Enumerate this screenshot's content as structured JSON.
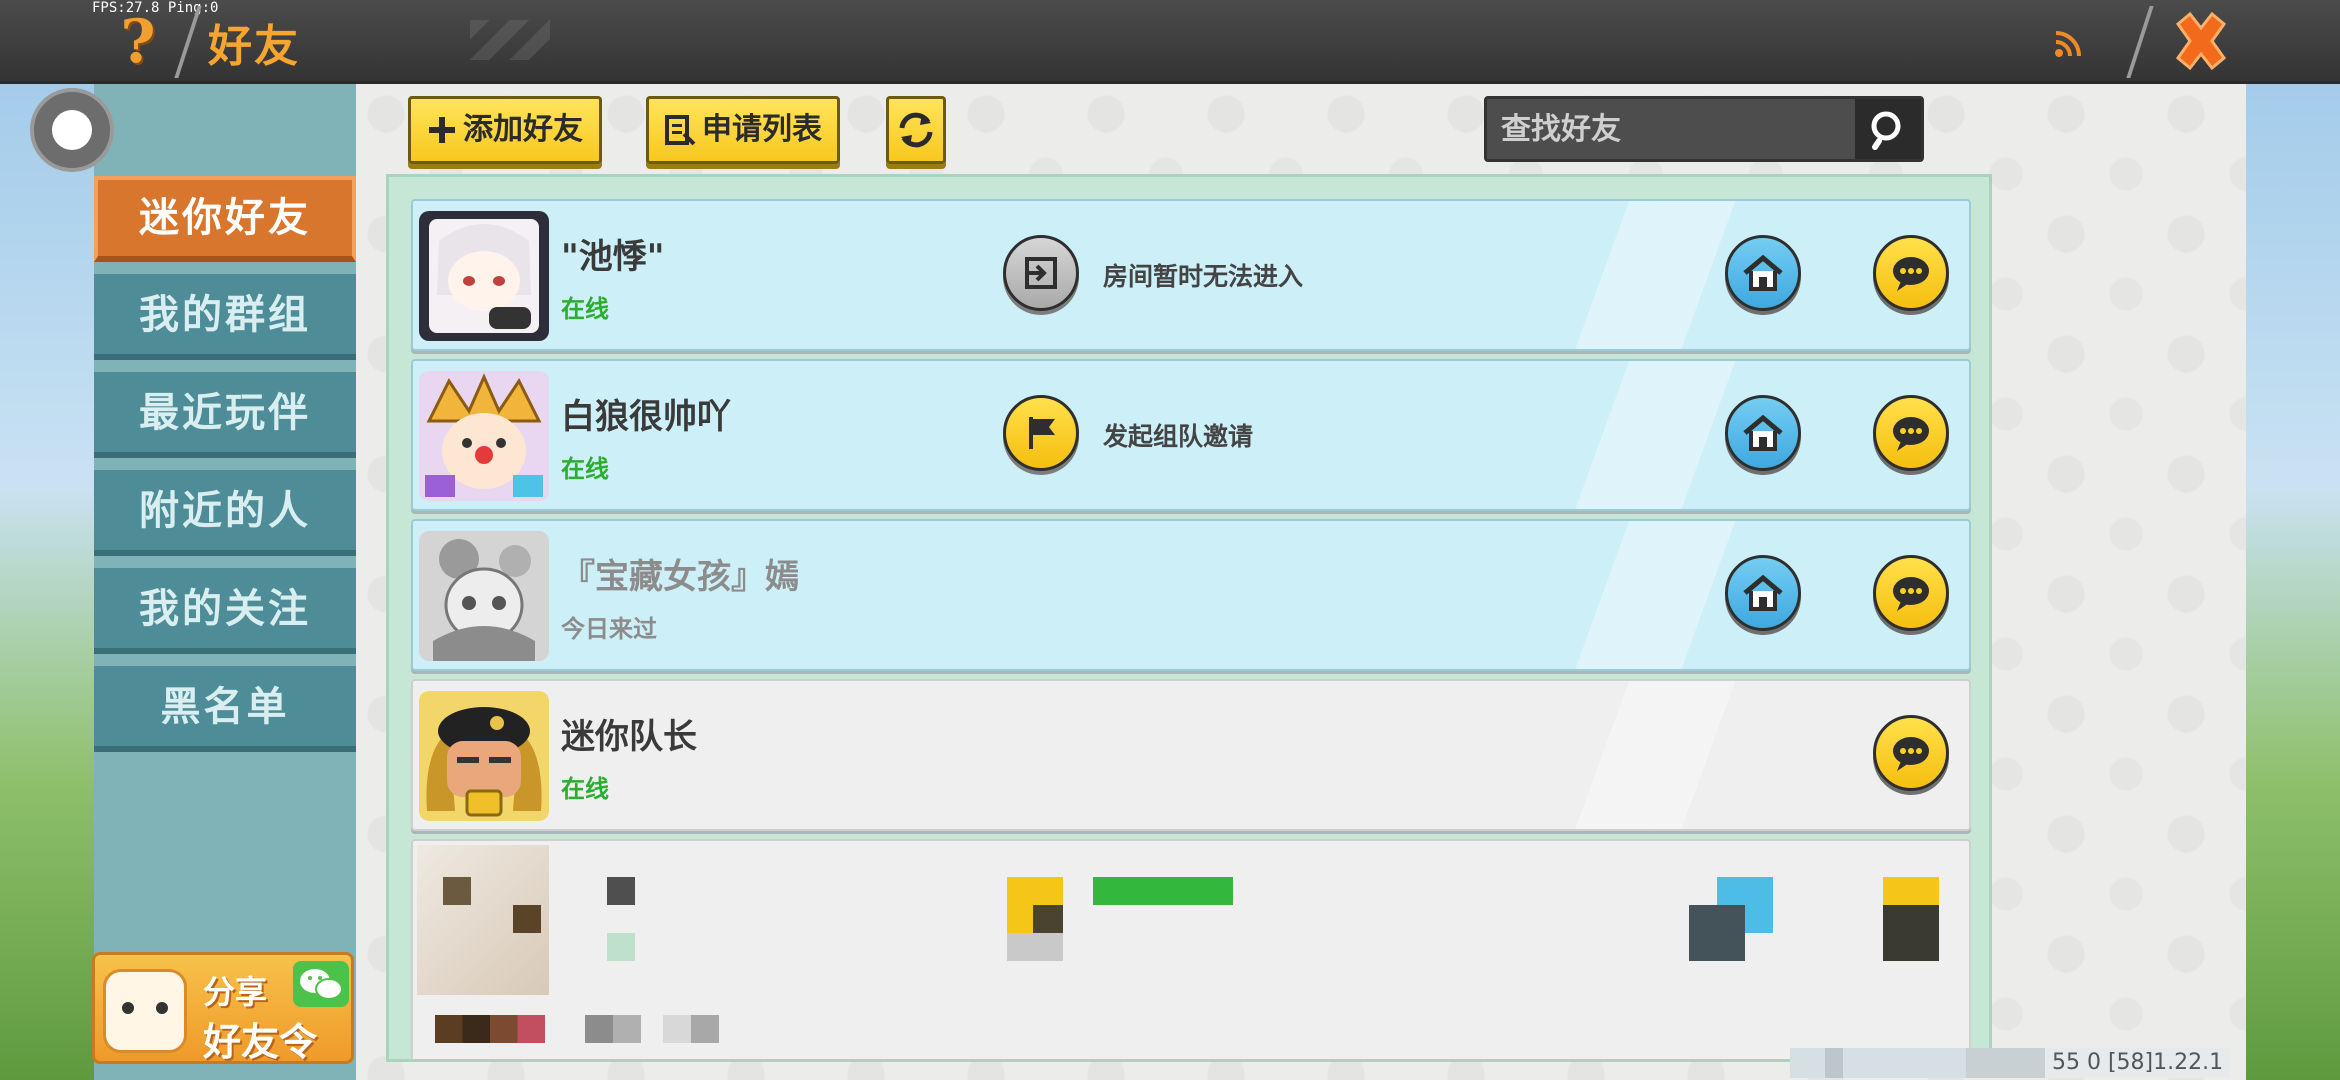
{
  "status": {
    "fps_text": "FPS:27.8  Ping:0"
  },
  "header": {
    "help_icon": "question-mark-icon",
    "title": "好友",
    "feed_icon": "rss-icon",
    "close_icon": "close-x-icon"
  },
  "sidebar": {
    "items": [
      {
        "label": "迷你好友",
        "active": true
      },
      {
        "label": "我的群组",
        "active": false
      },
      {
        "label": "最近玩伴",
        "active": false
      },
      {
        "label": "附近的人",
        "active": false
      },
      {
        "label": "我的关注",
        "active": false
      },
      {
        "label": "黑名单",
        "active": false
      }
    ],
    "share": {
      "line1": "分享",
      "line2": "好友令",
      "icon": "wechat-icon"
    }
  },
  "toolbar": {
    "add_friend_label": "添加好友",
    "request_list_label": "申请列表",
    "refresh_icon": "refresh-icon"
  },
  "search": {
    "placeholder": "查找好友",
    "icon": "search-icon"
  },
  "friends": [
    {
      "name": "\"池悸\"",
      "status": "在线",
      "online": true,
      "action_text": "房间暂时无法进入",
      "action_icon": "enter-room-icon",
      "has_home": true
    },
    {
      "name": "白狼很帅吖",
      "status": "在线",
      "online": true,
      "action_text": "发起组队邀请",
      "action_icon": "flag-icon",
      "has_home": true
    },
    {
      "name": "『宝藏女孩』嫣",
      "status": "今日来过",
      "online": false,
      "action_text": "",
      "has_home": true
    },
    {
      "name": "迷你队长",
      "status": "在线",
      "online": true,
      "action_text": "",
      "has_home": false
    }
  ],
  "footer": {
    "version": "55 0  [58]1.22.1"
  },
  "colors": {
    "accent_orange": "#d9762e",
    "nav_teal": "#4e8d97",
    "button_yellow": "#f7c81e",
    "online_green": "#2bae2f",
    "card_blue": "#cdeff7"
  }
}
